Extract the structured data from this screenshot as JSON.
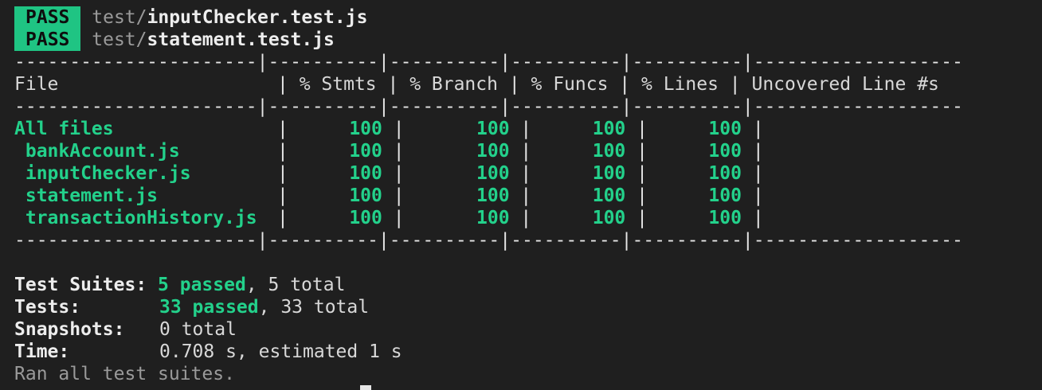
{
  "pass_lines": [
    {
      "badge": "PASS",
      "dir": "test/",
      "file": "inputChecker.test.js"
    },
    {
      "badge": "PASS",
      "dir": "test/",
      "file": "statement.test.js"
    }
  ],
  "table": {
    "rule_top": "----------------------|----------|----------|----------|----------|-------------------",
    "headers": {
      "file": "File",
      "stmts": "% Stmts",
      "branch": "% Branch",
      "funcs": "% Funcs",
      "lines": "% Lines",
      "uncovered": "Uncovered Line #s"
    },
    "rule_mid": "----------------------|----------|----------|----------|----------|-------------------",
    "rows": [
      {
        "file": "All files",
        "stmts": "100",
        "branch": "100",
        "funcs": "100",
        "lines": "100",
        "uncovered": ""
      },
      {
        "file": " bankAccount.js",
        "stmts": "100",
        "branch": "100",
        "funcs": "100",
        "lines": "100",
        "uncovered": ""
      },
      {
        "file": " inputChecker.js",
        "stmts": "100",
        "branch": "100",
        "funcs": "100",
        "lines": "100",
        "uncovered": ""
      },
      {
        "file": " statement.js",
        "stmts": "100",
        "branch": "100",
        "funcs": "100",
        "lines": "100",
        "uncovered": ""
      },
      {
        "file": " transactionHistory.js",
        "stmts": "100",
        "branch": "100",
        "funcs": "100",
        "lines": "100",
        "uncovered": ""
      }
    ],
    "rule_bottom": "----------------------|----------|----------|----------|----------|-------------------"
  },
  "summary": {
    "suites_label": "Test Suites:",
    "suites_passed": "5 passed",
    "suites_rest": ", 5 total",
    "tests_label": "Tests:",
    "tests_passed": "33 passed",
    "tests_rest": ", 33 total",
    "snapshots_label": "Snapshots:",
    "snapshots_value": "0 total",
    "time_label": "Time:",
    "time_value": "0.708 s, estimated 1 s",
    "ran_all": "Ran all test suites."
  },
  "colors": {
    "background": "#1f1f1f",
    "pass_badge": "#1fc483",
    "green_text": "#23d18b",
    "dim_text": "#9a9a9a"
  }
}
